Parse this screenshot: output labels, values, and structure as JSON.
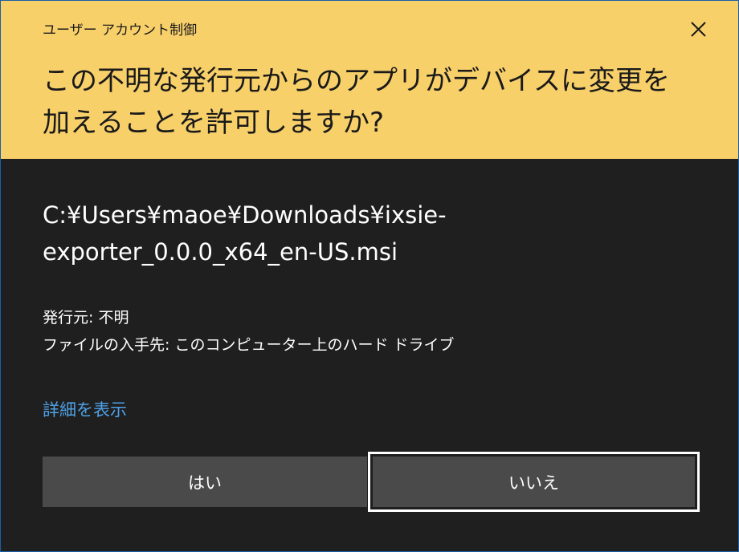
{
  "dialog": {
    "caption": "ユーザー アカウント制御",
    "question_line1": "この不明な発行元からのアプリがデバイスに変更を",
    "question_line2": "加えることを許可しますか?",
    "close_icon": "close-icon"
  },
  "program": {
    "path_line1": "C:¥Users¥maoe¥Downloads¥ixsie-",
    "path_line2": "exporter_0.0.0_x64_en-US.msi"
  },
  "meta": {
    "publisher": "発行元: 不明",
    "origin": "ファイルの入手先: このコンピューター上のハード ドライブ"
  },
  "details_link": "詳細を表示",
  "buttons": {
    "yes": "はい",
    "no": "いいえ"
  },
  "colors": {
    "header_bg": "#f8d06a",
    "body_bg": "#1f1f1f",
    "button_bg": "#4a4a4a",
    "link": "#4ea1e6",
    "frame": "#1a5fa8"
  }
}
